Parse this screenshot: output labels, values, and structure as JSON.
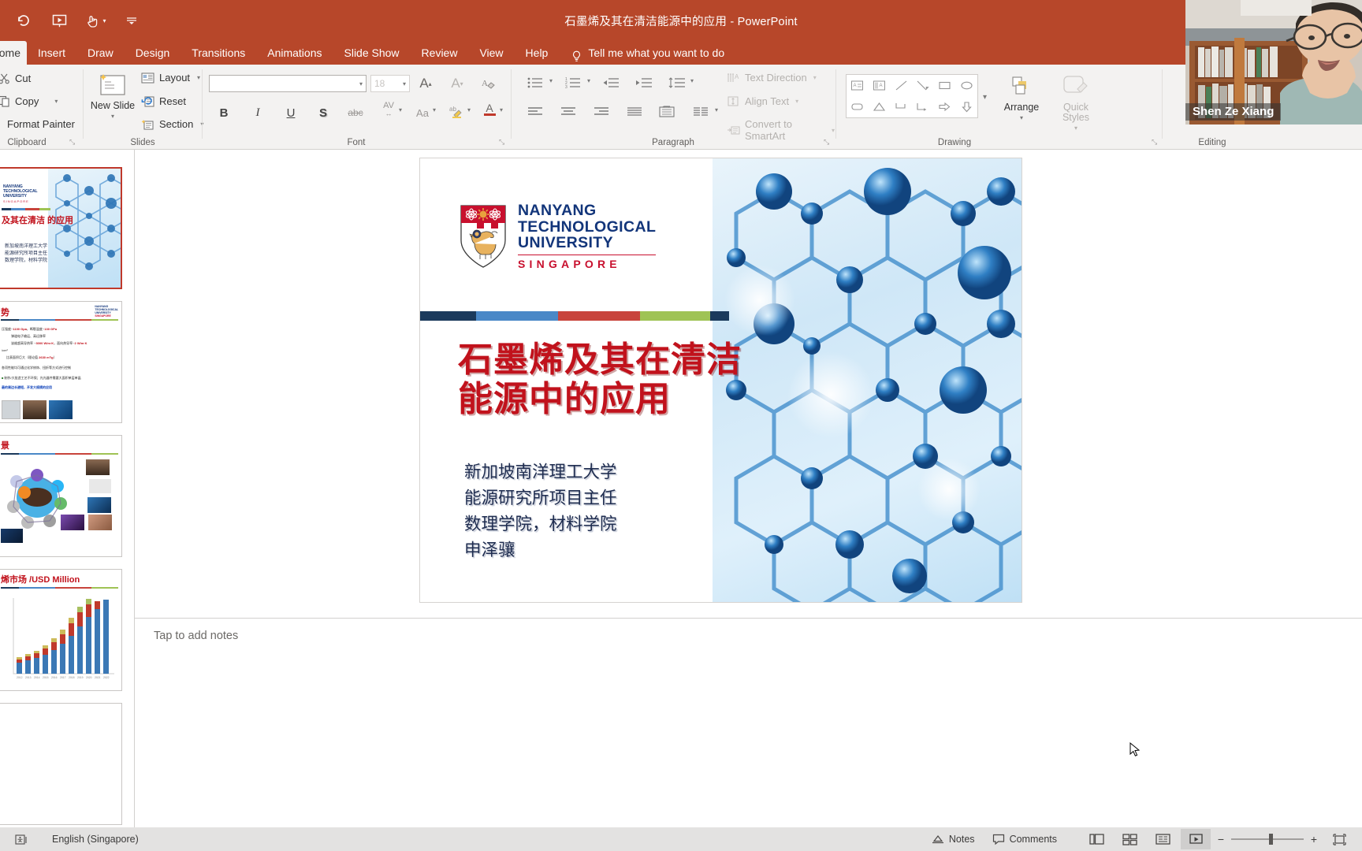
{
  "window": {
    "title": "石墨烯及其在清洁能源中的应用",
    "app_name": "PowerPoint",
    "title_separator": "-"
  },
  "quick_access": {
    "items": [
      {
        "name": "undo-icon",
        "label": "Undo"
      },
      {
        "name": "start-from-beginning-icon",
        "label": "Start From Beginning"
      },
      {
        "name": "touch-mode-icon",
        "label": "Touch/Mouse Mode"
      },
      {
        "name": "customize-quick-access-icon",
        "label": "Customize Quick Access Toolbar"
      }
    ]
  },
  "ribbon": {
    "tabs": [
      {
        "label": "Home",
        "active": true
      },
      {
        "label": "Insert",
        "active": false
      },
      {
        "label": "Draw",
        "active": false
      },
      {
        "label": "Design",
        "active": false
      },
      {
        "label": "Transitions",
        "active": false
      },
      {
        "label": "Animations",
        "active": false
      },
      {
        "label": "Slide Show",
        "active": false
      },
      {
        "label": "Review",
        "active": false
      },
      {
        "label": "View",
        "active": false
      },
      {
        "label": "Help",
        "active": false
      }
    ],
    "tell_me": "Tell me what you want to do",
    "groups": {
      "clipboard": {
        "label": "Clipboard",
        "cut": "Cut",
        "copy": "Copy",
        "format_painter": "Format Painter"
      },
      "slides": {
        "label": "Slides",
        "new_slide": "New Slide",
        "layout": "Layout",
        "reset": "Reset",
        "section": "Section"
      },
      "font": {
        "label": "Font",
        "font_name": "",
        "font_name_placeholder": "",
        "font_size": "18",
        "grow_font": "Increase Font Size",
        "shrink_font": "Decrease Font Size",
        "clear_formatting": "Clear All Formatting",
        "bold": "B",
        "italic": "I",
        "underline": "U",
        "shadow": "S",
        "strikethrough": "abc",
        "character_spacing": "AV",
        "change_case": "Aa",
        "highlight": "Text Highlight Color",
        "font_color": "A"
      },
      "paragraph": {
        "label": "Paragraph",
        "text_direction": "Text Direction",
        "align_text": "Align Text",
        "convert_to_smartart": "Convert to SmartArt"
      },
      "drawing": {
        "label": "Drawing",
        "arrange": "Arrange",
        "quick_styles": "Quick Styles"
      },
      "editing": {
        "label": "Editing"
      }
    }
  },
  "slide": {
    "logo": {
      "line1": "NANYANG",
      "line2": "TECHNOLOGICAL",
      "line3": "UNIVERSITY",
      "country": "SINGAPORE"
    },
    "color_bar": [
      "#1b3a5c",
      "#4a88c7",
      "#c8443c",
      "#9fc355",
      "#1b3a5c"
    ],
    "title_lines": [
      "石墨烯及其在清洁",
      "能源中的应用"
    ],
    "subtitle_lines": [
      "新加坡南洋理工大学",
      "能源研究所项目主任",
      "数理学院，材料学院",
      "申泽骧"
    ],
    "title_color": "#c1121c",
    "subtitle_color": "#1f2d50"
  },
  "thumbnails": [
    {
      "index": 1,
      "selected": true,
      "title": "及其在清洁 的应用"
    },
    {
      "index": 2,
      "selected": false,
      "title": "势"
    },
    {
      "index": 3,
      "selected": false,
      "title": "景"
    },
    {
      "index": 4,
      "selected": false,
      "title": "烯市场 /USD Million"
    }
  ],
  "notes": {
    "placeholder": "Tap to add notes"
  },
  "status_bar": {
    "language": "English (Singapore)",
    "accessibility": "Accessibility Checker",
    "notes_button": "Notes",
    "comments_button": "Comments",
    "views": [
      {
        "name": "normal-view",
        "active": false
      },
      {
        "name": "slide-sorter-view",
        "active": false
      },
      {
        "name": "reading-view",
        "active": false
      },
      {
        "name": "slide-show-view",
        "active": true
      }
    ],
    "zoom_out": "−",
    "zoom_in": "+",
    "fit_to_window": "Fit slide to current window"
  },
  "webcam": {
    "presenter_name": "Shen Ze Xiang"
  },
  "theme": {
    "title_bar": "#b7472a",
    "ribbon_bg": "#f3f2f1",
    "status_bg": "#e3e2e1",
    "selection": "#c0392b"
  }
}
